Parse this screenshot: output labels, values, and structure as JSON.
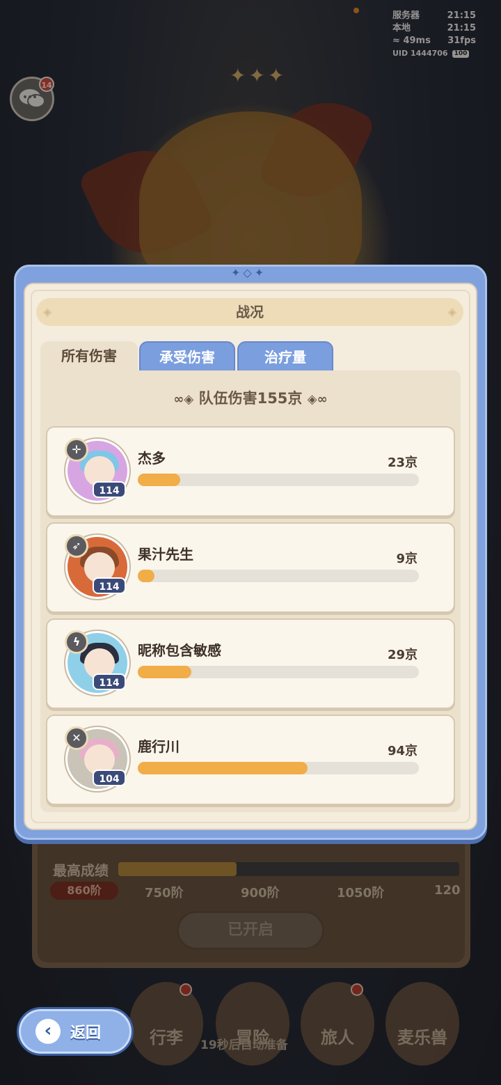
{
  "status": {
    "server_label": "服务器",
    "server_time": "21:15",
    "local_label": "本地",
    "local_time": "21:15",
    "ping": "49ms",
    "fps": "31fps",
    "uid": "UID 1444706",
    "battery": "100"
  },
  "chat": {
    "badge": "14"
  },
  "panel": {
    "title": "战况",
    "tabs": [
      {
        "label": "所有伤害",
        "active": true
      },
      {
        "label": "承受伤害",
        "active": false
      },
      {
        "label": "治疗量",
        "active": false
      }
    ],
    "team_total": "队伍伤害155京",
    "members": [
      {
        "name": "杰多",
        "damage": "23京",
        "level": "114",
        "role_icon": "sword-cross-icon",
        "share": 0.15,
        "hair_color": "#7fc7e6",
        "bg_color": "#d7a6e2"
      },
      {
        "name": "果汁先生",
        "damage": "9京",
        "level": "114",
        "role_icon": "spear-icon",
        "share": 0.06,
        "hair_color": "#8a4a2a",
        "bg_color": "#d86a3a"
      },
      {
        "name": "昵称包含敏感",
        "damage": "29京",
        "level": "114",
        "role_icon": "bolt-icon",
        "share": 0.19,
        "hair_color": "#2b2f3e",
        "bg_color": "#8fd0e8"
      },
      {
        "name": "鹿行川",
        "damage": "94京",
        "level": "104",
        "role_icon": "crossed-swords-icon",
        "share": 0.605,
        "hair_color": "#e8b0c8",
        "bg_color": "#c9c3b8"
      }
    ]
  },
  "background": {
    "best_label": "最高成绩",
    "best_value": "860阶",
    "tiers": [
      "750阶",
      "900阶",
      "1050阶",
      "120"
    ],
    "opened": "已开启",
    "nav": [
      "行李",
      "冒险",
      "旅人",
      "麦乐兽"
    ],
    "auto_ready": "19秒后自动准备"
  },
  "back_button": {
    "label": "返回"
  }
}
